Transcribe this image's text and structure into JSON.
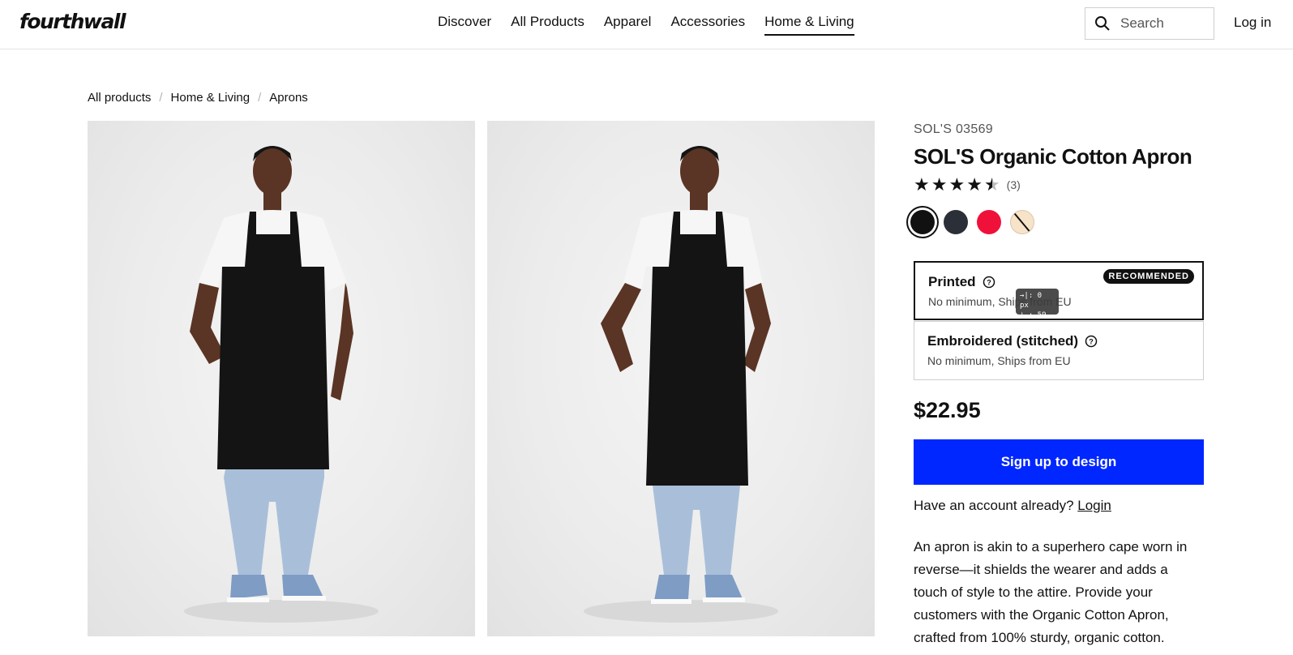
{
  "header": {
    "logo": "fourthwall",
    "nav": [
      "Discover",
      "All Products",
      "Apparel",
      "Accessories",
      "Home & Living"
    ],
    "active_nav": "Home & Living",
    "search_placeholder": "Search",
    "login": "Log in"
  },
  "breadcrumb": [
    "All products",
    "Home & Living",
    "Aprons"
  ],
  "product": {
    "sku": "SOL'S 03569",
    "title": "SOL'S Organic Cotton Apron",
    "rating_value": 4.5,
    "rating_count": "(3)",
    "colors": [
      {
        "name": "black",
        "hex": "#111111",
        "selected": true
      },
      {
        "name": "navy",
        "hex": "#2b2f38",
        "selected": false
      },
      {
        "name": "red",
        "hex": "#f0113a",
        "selected": false
      },
      {
        "name": "natural",
        "hex": "#f7e3c8",
        "selected": false
      }
    ],
    "options": [
      {
        "name": "Printed",
        "desc": "No minimum, Ships from EU",
        "badge": "RECOMMENDED",
        "selected": true
      },
      {
        "name": "Embroidered (stitched)",
        "desc": "No minimum, Ships from EU",
        "badge": "",
        "selected": false
      }
    ],
    "price": "$22.95",
    "cta": "Sign up to design",
    "account_prompt": "Have an account already?",
    "account_link": "Login",
    "description": "An apron is akin to a superhero cape worn in reverse—it shields the wearer and adds a touch of style to the attire. Provide your customers with the Organic Cotton Apron, crafted from 100% sturdy, organic cotton."
  },
  "tooltip": {
    "line1": "→|:   0 px",
    "line2": "⊥ : 59 px"
  },
  "colors": {
    "accent": "#0027ff",
    "text": "#111111",
    "muted": "#555555",
    "border": "#cfcfcf",
    "photo_bg": "#ececec"
  }
}
